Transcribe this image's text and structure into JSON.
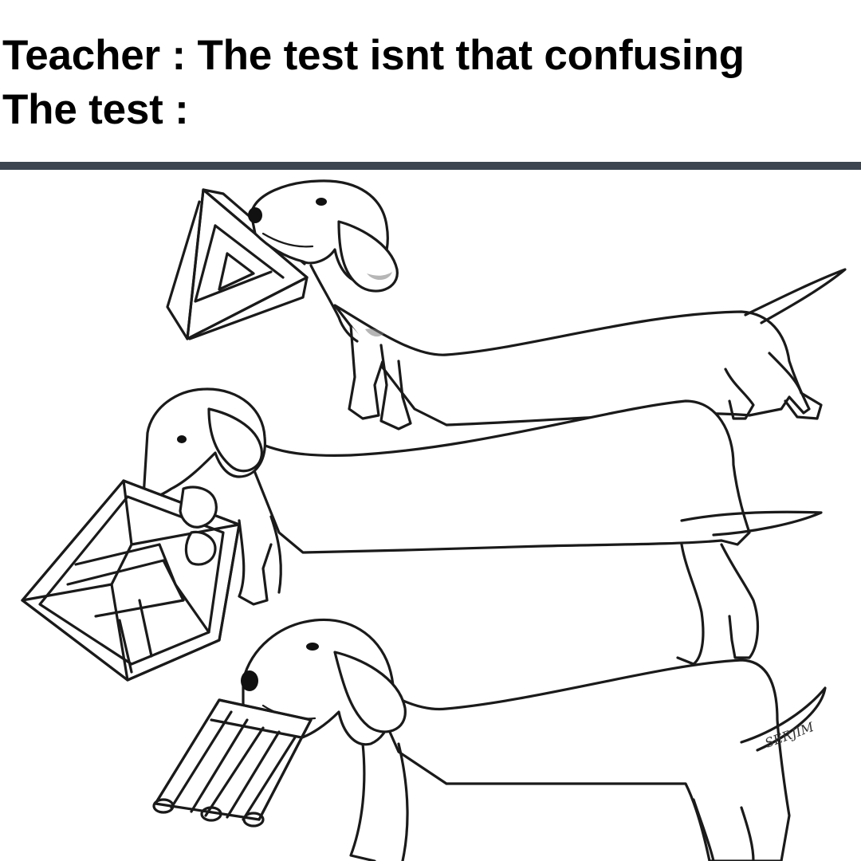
{
  "caption": {
    "line1": "Teacher : The test isnt that confusing",
    "line2": "The test :"
  },
  "illustration": {
    "signature": "SERJIM"
  },
  "colors": {
    "background": "#ffffff",
    "text": "#000000",
    "divider": "#3c4550",
    "ink": "#1a1a1a"
  }
}
